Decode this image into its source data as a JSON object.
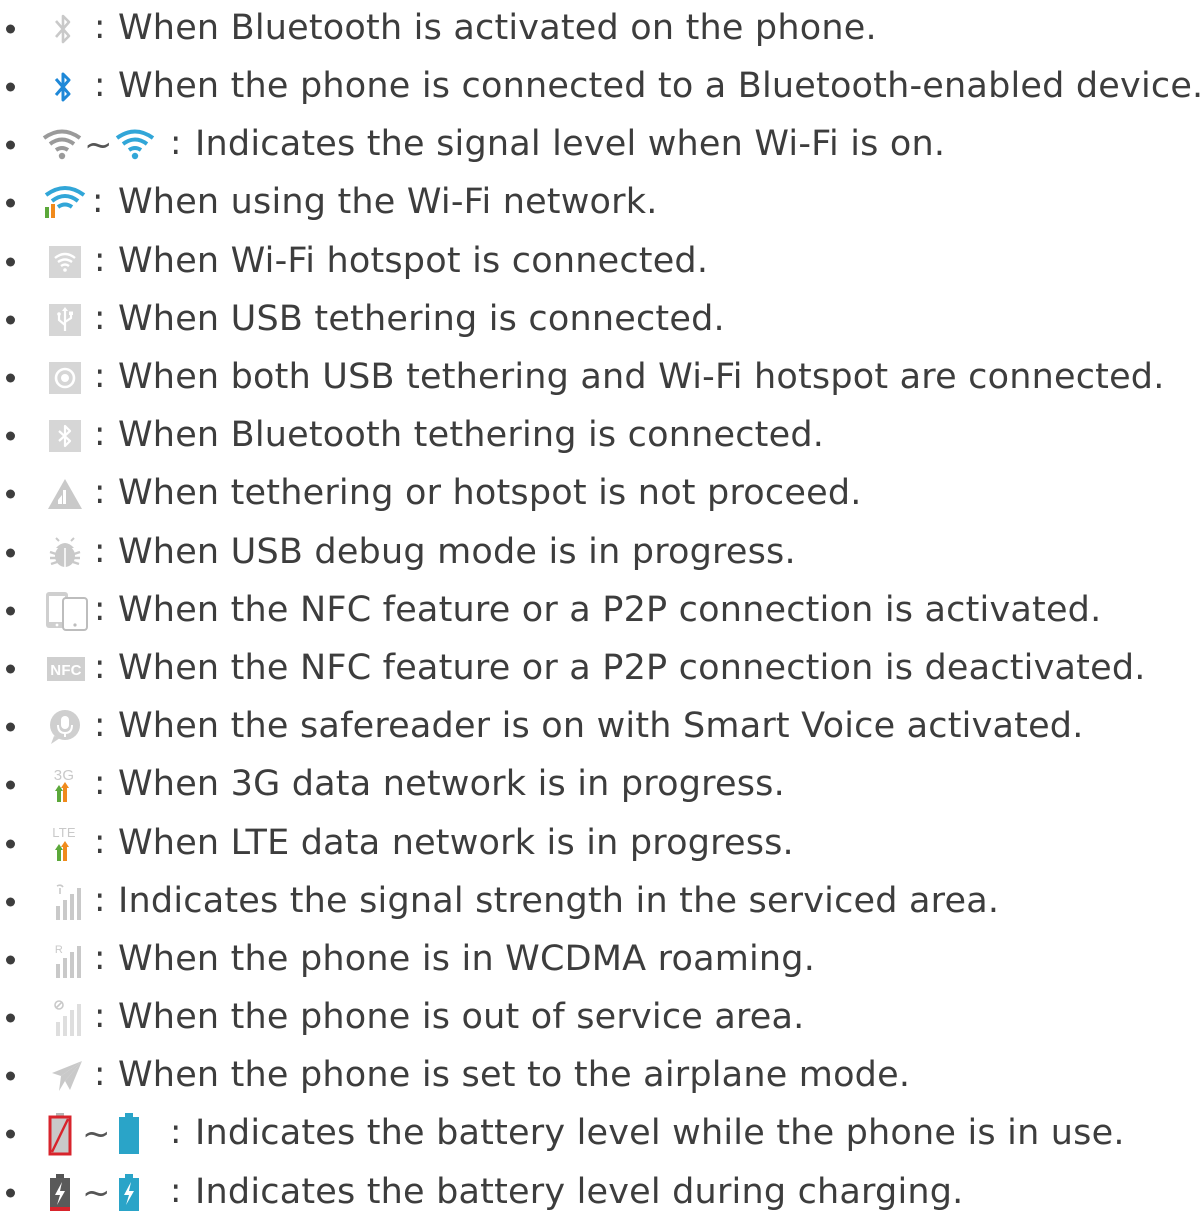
{
  "legend": {
    "separator": ":",
    "range_symbol": "~",
    "items": [
      {
        "icon": "bluetooth-on-icon",
        "text": "When Bluetooth is activated on the phone."
      },
      {
        "icon": "bluetooth-connected-icon",
        "text": "When the phone is connected to a Bluetooth-enabled device."
      },
      {
        "icon": "wifi-signal-range-icon",
        "text": "Indicates the signal level when Wi-Fi is on."
      },
      {
        "icon": "wifi-in-use-icon",
        "text": "When using the Wi-Fi network."
      },
      {
        "icon": "wifi-hotspot-icon",
        "text": "When Wi-Fi hotspot is connected."
      },
      {
        "icon": "usb-tethering-icon",
        "text": "When USB tethering is connected."
      },
      {
        "icon": "usb-wifi-tethering-icon",
        "text": "When both USB tethering and Wi-Fi hotspot are connected."
      },
      {
        "icon": "bluetooth-tethering-icon",
        "text": "When Bluetooth tethering is connected."
      },
      {
        "icon": "tethering-warning-icon",
        "text": "When tethering or hotspot is not proceed."
      },
      {
        "icon": "usb-debug-icon",
        "text": "When USB debug mode is in progress."
      },
      {
        "icon": "nfc-p2p-active-icon",
        "text": "When the NFC feature or a P2P connection is activated."
      },
      {
        "icon": "nfc-inactive-icon",
        "text": "When the NFC feature or a P2P connection is deactivated."
      },
      {
        "icon": "safereader-voice-icon",
        "text": "When the safereader is on with Smart Voice activated."
      },
      {
        "icon": "data-3g-icon",
        "text": "When 3G data network is in progress."
      },
      {
        "icon": "data-lte-icon",
        "text": "When LTE data network is in progress."
      },
      {
        "icon": "signal-strength-icon",
        "text": "Indicates the signal strength in the serviced area."
      },
      {
        "icon": "signal-roaming-icon",
        "text": "When the phone is in WCDMA roaming."
      },
      {
        "icon": "no-service-icon",
        "text": "When the phone is out of service area."
      },
      {
        "icon": "airplane-mode-icon",
        "text": "When the phone is set to the airplane mode."
      },
      {
        "icon": "battery-level-range-icon",
        "text": "Indicates the battery level while the phone is in use."
      },
      {
        "icon": "battery-charging-range-icon",
        "text": "Indicates the battery level during charging."
      }
    ],
    "badges": {
      "nfc": "NFC",
      "3g": "3G",
      "lte": "LTE",
      "roaming": "R"
    }
  },
  "colors": {
    "text": "#3d3d3d",
    "icon_gray": "#c9c9c9",
    "bluetooth_blue": "#1e88d8",
    "wifi_teal": "#31a6d8",
    "data_orange": "#f08a1c",
    "data_green": "#5ba83a",
    "battery_red": "#d8242c",
    "battery_teal": "#2aa4c8"
  }
}
